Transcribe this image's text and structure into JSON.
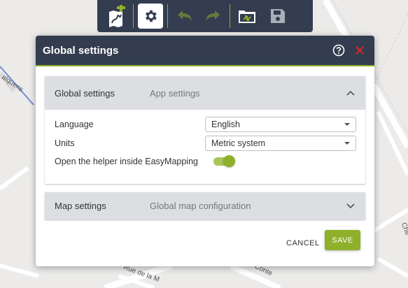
{
  "map": {
    "street_labels": [
      "alquens",
      "Rue de la M",
      "Conte",
      "Che"
    ]
  },
  "toolbar": {
    "icons": [
      "new-map-icon",
      "gear-icon",
      "undo-icon",
      "redo-icon",
      "open-folder-icon",
      "save-disk-icon"
    ]
  },
  "dialog": {
    "title": "Global settings",
    "sections": [
      {
        "title": "Global settings",
        "subtitle": "App settings",
        "expanded": true
      },
      {
        "title": "Map settings",
        "subtitle": "Global map configuration",
        "expanded": false
      }
    ],
    "fields": {
      "language": {
        "label": "Language",
        "value": "English"
      },
      "units": {
        "label": "Units",
        "value": "Metric system"
      },
      "helper": {
        "label": "Open the helper inside EasyMapping",
        "enabled": true
      }
    },
    "cancel_label": "CANCEL",
    "save_label": "SAVE"
  },
  "colors": {
    "header": "#333d4f",
    "accent": "#8fb02a",
    "close": "#e0262c"
  }
}
